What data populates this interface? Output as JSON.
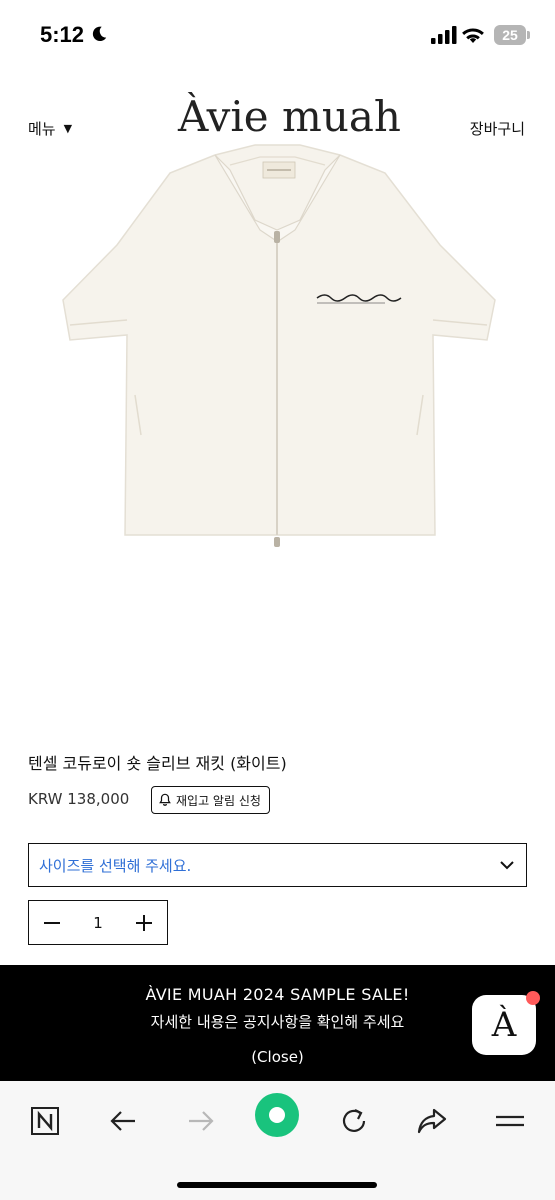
{
  "status_bar": {
    "time": "5:12",
    "battery_level": "25",
    "icons": [
      "moon-icon",
      "signal-icon",
      "wifi-icon",
      "battery-icon"
    ]
  },
  "header": {
    "menu_label": "메뉴",
    "menu_caret": "▼",
    "logo_text": "Àvie muah",
    "cart_label": "장바구니"
  },
  "product": {
    "image_icon": "short-sleeve-zip-jacket-image",
    "name": "텐셀 코듀로이 숏 슬리브 재킷 (화이트)",
    "price": "KRW 138,000",
    "restock_button": "재입고 알림 신청",
    "size_placeholder": "사이즈를 선택해 주세요.",
    "quantity": "1"
  },
  "promo": {
    "title": "ÀVIE MUAH 2024 SAMPLE SALE!",
    "subtitle": "자세한 내용은 공지사항을 확인해 주세요",
    "close_label": "(Close)"
  },
  "chat_badge": {
    "letter": "À"
  },
  "browser_toolbar": {
    "items": [
      "naver-home-icon",
      "back-icon",
      "forward-icon",
      "green-dot-icon",
      "reload-icon",
      "share-icon",
      "menu-icon"
    ]
  },
  "colors": {
    "link_blue": "#2f6fd6",
    "banner_bg": "#000000",
    "notification": "#ff5a5a",
    "green_button": "#19c37d"
  }
}
